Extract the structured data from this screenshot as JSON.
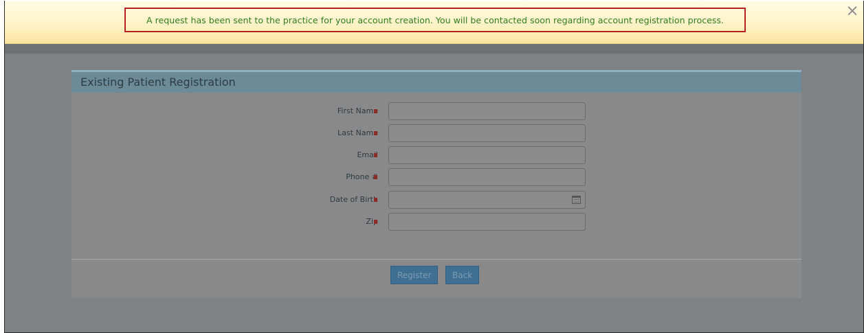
{
  "banner": {
    "message": "A request has been sent to the practice for your account creation. You will be contacted soon regarding account registration process.",
    "close_glyph": "×"
  },
  "card": {
    "title": "Existing Patient Registration"
  },
  "form": {
    "fields": [
      {
        "label": "First Name",
        "value": ""
      },
      {
        "label": "Last Name",
        "value": ""
      },
      {
        "label": "Email",
        "value": ""
      },
      {
        "label": "Phone #",
        "value": ""
      },
      {
        "label": "Date of Birth",
        "value": ""
      },
      {
        "label": "Zip",
        "value": ""
      }
    ]
  },
  "actions": {
    "register_label": "Register",
    "back_label": "Back"
  },
  "colors": {
    "message_text": "#2f7d1e",
    "highlight_border": "#b41f1f",
    "button_bg": "#3f6f93"
  }
}
